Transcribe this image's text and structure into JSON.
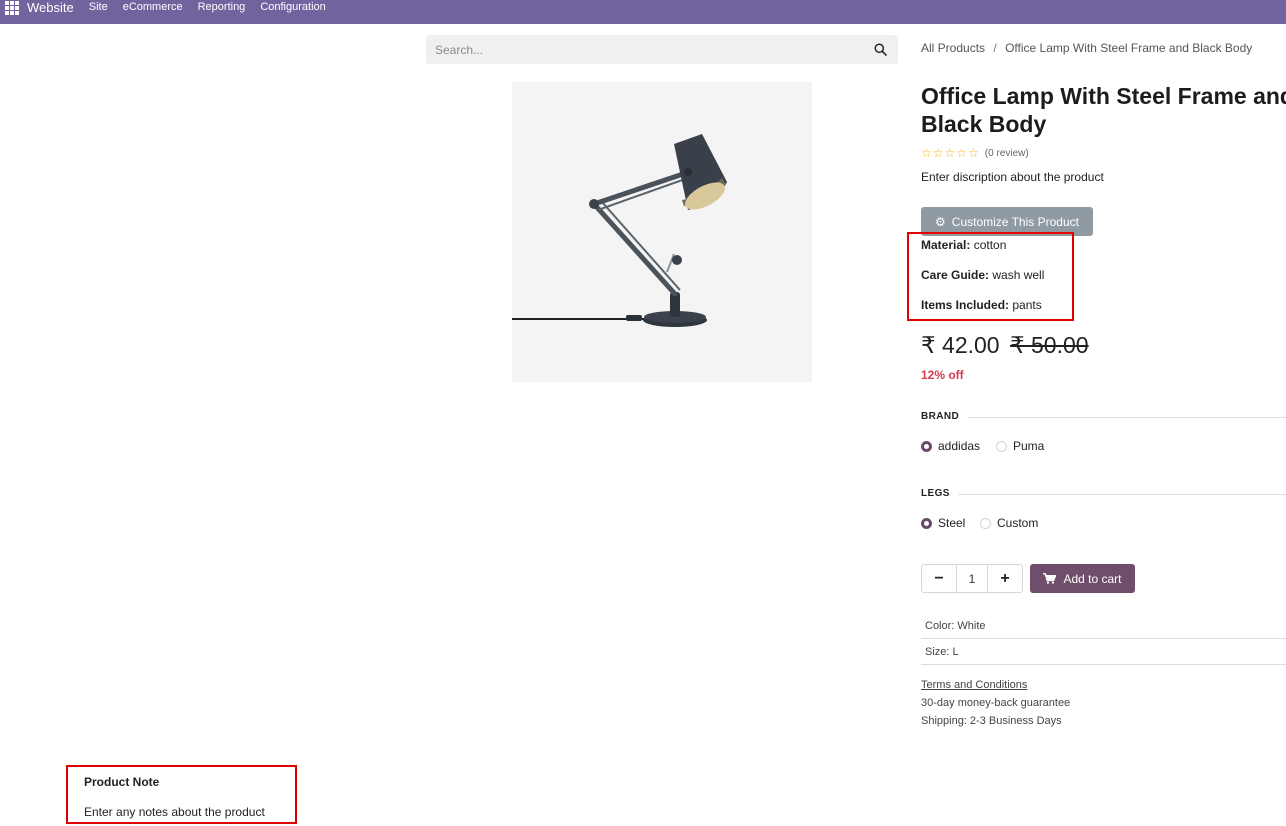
{
  "topbar": {
    "brand": "Website",
    "menu": [
      "Site",
      "eCommerce",
      "Reporting",
      "Configuration"
    ]
  },
  "search": {
    "placeholder": "Search..."
  },
  "breadcrumb": {
    "parent": "All Products",
    "separator": "/",
    "current": "Office Lamp With Steel Frame and Black Body"
  },
  "product": {
    "title": "Office Lamp With Steel Frame and Black Body",
    "rating_stars": "☆☆☆☆☆",
    "rating_text": "(0 review)",
    "description": "Enter discription about the product",
    "customize_label": "Customize This Product",
    "attributes": [
      {
        "label": "Material:",
        "value": "cotton"
      },
      {
        "label": "Care Guide:",
        "value": "wash well"
      },
      {
        "label": "Items Included:",
        "value": "pants"
      }
    ],
    "price": "₹ 42.00",
    "old_price": "₹ 50.00",
    "discount": "12% off"
  },
  "variants": {
    "brand": {
      "label": "BRAND",
      "options": [
        "addidas",
        "Puma"
      ],
      "selected": "addidas"
    },
    "legs": {
      "label": "LEGS",
      "options": [
        "Steel",
        "Custom"
      ],
      "selected": "Steel"
    }
  },
  "cart": {
    "minus": "−",
    "plus": "+",
    "quantity": "1",
    "add_label": "Add to cart"
  },
  "specs": [
    "Color: White",
    "Size: L"
  ],
  "info": {
    "terms": "Terms and Conditions",
    "guarantee": "30-day money-back guarantee",
    "shipping": "Shipping: 2-3 Business Days"
  },
  "note": {
    "title": "Product Note",
    "text": "Enter any notes about the product"
  },
  "colors": {
    "topbar": "#71639e",
    "primary": "#6f4e6c",
    "discount": "#d93a4f",
    "highlight_box": "#e00000",
    "star": "#f3b000"
  }
}
